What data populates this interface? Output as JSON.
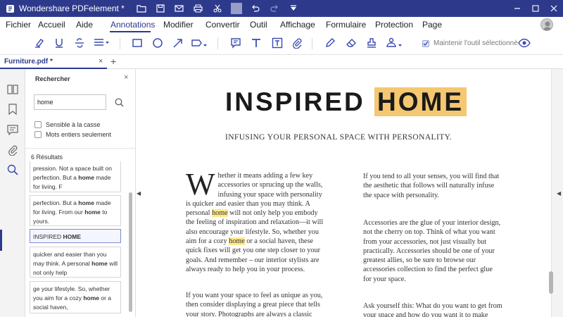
{
  "app": {
    "title": "Wondershare PDFelement *"
  },
  "menu": {
    "items": [
      "Fichier",
      "Accueil",
      "Aide",
      "Annotations",
      "Modifier",
      "Convertir",
      "Outil",
      "Affichage",
      "Formulaire",
      "Protection",
      "Page"
    ],
    "active": "Annotations"
  },
  "toolbar": {
    "keep_tool_label": "Maintenir l'outil sélectionné"
  },
  "tab": {
    "doc_label": "Furniture.pdf *",
    "close": "×",
    "add": "+"
  },
  "search": {
    "title": "Rechercher",
    "close": "×",
    "query": "home",
    "opt_case": "Sensible à la casse",
    "opt_whole": "Mots entiers seulement",
    "results_count": "6 Résultats",
    "results": [
      [
        "pression. Not a space built on perfection. But a ",
        "home",
        " made for living. F"
      ],
      [
        "perfection. But a ",
        "home",
        " made for living. From our ",
        "home",
        " to yours."
      ],
      [
        "INSPIRED ",
        "HOME",
        ""
      ],
      [
        "quicker and easier than you may think. A personal ",
        "home",
        " will not only help"
      ],
      [
        "ge your lifestyle. So, whether you aim for a cozy ",
        "home",
        " or a social haven,"
      ]
    ]
  },
  "doc": {
    "heading_a": "INSPIRED ",
    "heading_b": "HOME",
    "subtitle": "INFUSING YOUR PERSONAL SPACE WITH PERSONALITY.",
    "dropcap": "W",
    "left_p1_a": "hether it means adding a few key accessories or sprucing up the walls, infusing your space with personality is quicker and easier than you may think. A personal ",
    "left_p1_hl1": "home",
    "left_p1_b": " will not only help you embody the feeling of inspiration and relaxation—it will also encourage your lifestyle. So, whether you aim for a cozy ",
    "left_p1_hl2": "home",
    "left_p1_c": " or a social haven, these quick fixes will get you one step closer to your goals. And remember – our interior stylists are always ready to help you in your process.",
    "left_p2": "If you want your space to feel as unique as you, then consider displaying a great piece that tells your story. Photographs are always a classic",
    "right_p1": "If you tend to all your senses, you will find that the aesthetic that follows will naturally infuse the space with personality.",
    "right_p2": "Accessories are the glue of your interior design, not the cherry on top. Think of what you want from your accessories, not just visually but practically. Accessories should be one of your greatest allies, so be sure to browse our accessories collection to find the perfect glue for your space.",
    "right_p3": "Ask yourself this: What do you want to get from your space and how do you want it to make"
  },
  "colors": {
    "brand": "#2d3a8c",
    "highlight_heading": "#f4c770",
    "highlight_word": "#ffe98a",
    "icon": "#3a4ab0"
  },
  "icons": {
    "titlebar": [
      "folder-icon",
      "save-icon",
      "mail-icon",
      "print-icon",
      "scissors-icon",
      "undo-icon",
      "redo-icon",
      "dropdown-icon"
    ],
    "toolbar": [
      "highlight-icon",
      "underline-icon",
      "strikethrough-icon",
      "lines-icon",
      "rectangle-icon",
      "ellipse-icon",
      "arrow-icon",
      "area-icon",
      "comment-icon",
      "text-icon",
      "textbox-icon",
      "attach-icon",
      "pencil-icon",
      "eraser-icon",
      "stamp-icon",
      "signature-icon",
      "eye-icon"
    ]
  }
}
